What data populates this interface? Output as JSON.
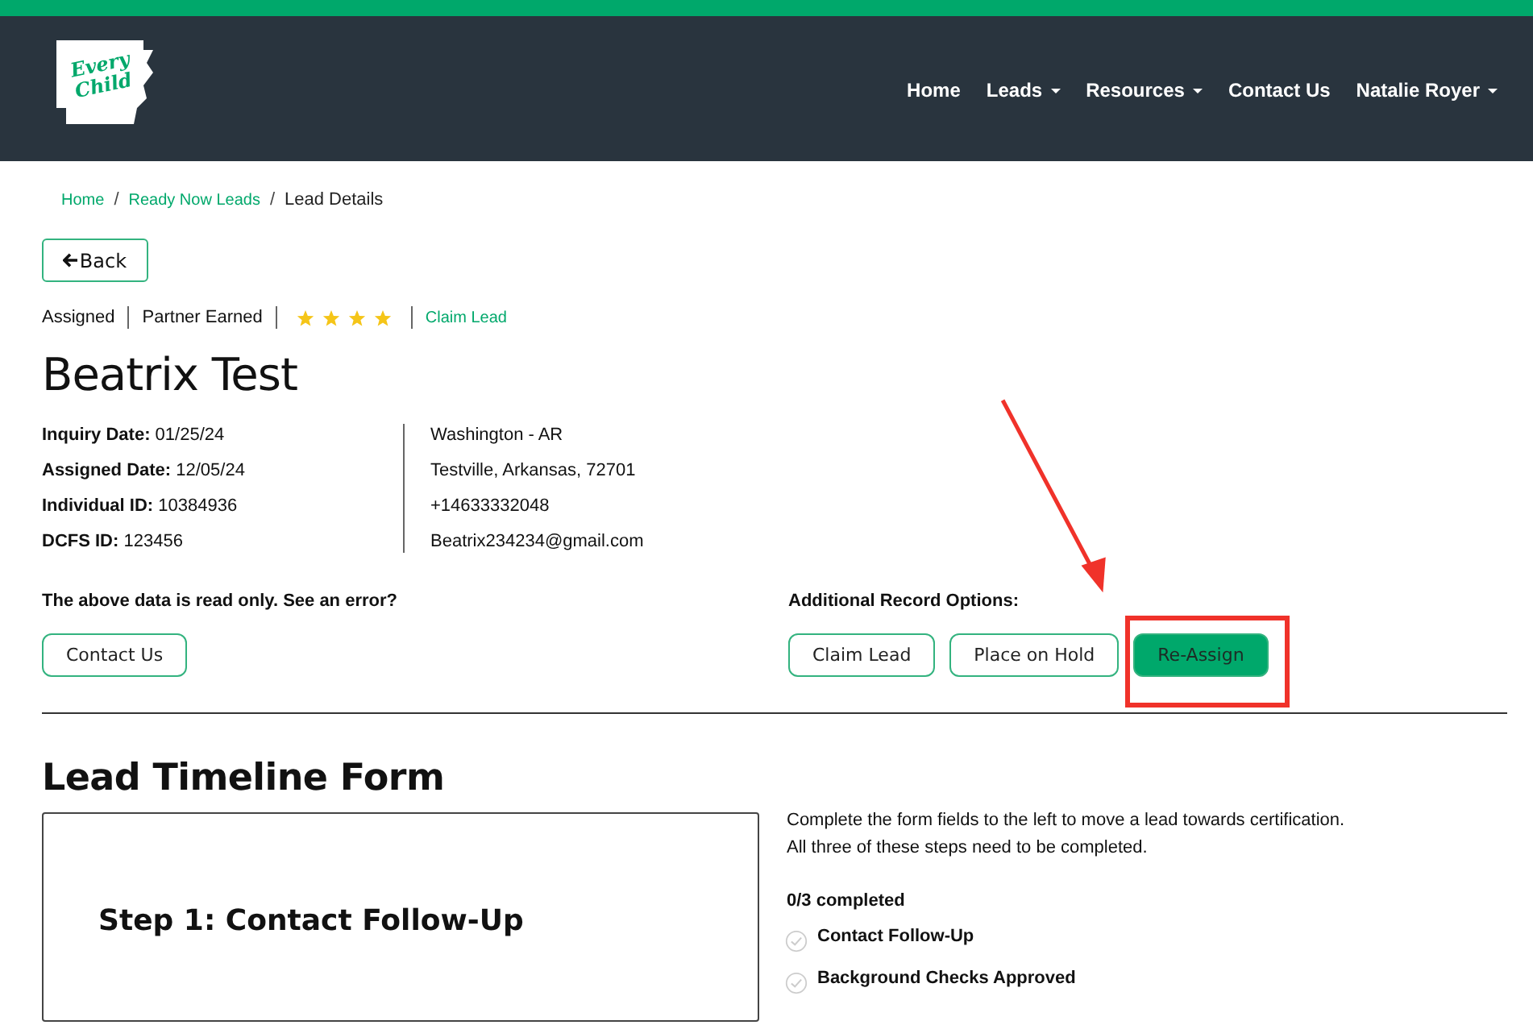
{
  "logo": {
    "line1": "Every",
    "line2": "Child"
  },
  "nav": [
    {
      "label": "Home",
      "dropdown": false
    },
    {
      "label": "Leads",
      "dropdown": true
    },
    {
      "label": "Resources",
      "dropdown": true
    },
    {
      "label": "Contact Us",
      "dropdown": false
    },
    {
      "label": "Natalie Royer",
      "dropdown": true
    }
  ],
  "breadcrumb_separator": "/",
  "breadcrumb": [
    {
      "label": "Home",
      "link": true
    },
    {
      "label": "Ready Now Leads",
      "link": true
    },
    {
      "label": "Lead Details",
      "link": false
    }
  ],
  "back_button": "Back",
  "status": {
    "assignment": "Assigned",
    "partner": "Partner Earned",
    "stars": 4,
    "claim_link": "Claim Lead"
  },
  "lead_name": "Beatrix Test",
  "details": [
    {
      "label": "Inquiry Date:",
      "value": "01/25/24"
    },
    {
      "label": "Assigned Date:",
      "value": "12/05/24"
    },
    {
      "label": "Individual ID:",
      "value": "10384936"
    },
    {
      "label": "DCFS ID:",
      "value": "123456"
    }
  ],
  "contact": [
    "Washington - AR",
    "Testville, Arkansas, 72701",
    "+14633332048",
    "Beatrix234234@gmail.com"
  ],
  "readonly_note": "The above data is read only. See an error?",
  "contact_button": "Contact Us",
  "options_heading": "Additional Record Options:",
  "option_buttons": [
    {
      "label": "Claim Lead",
      "primary": false,
      "highlighted": false
    },
    {
      "label": "Place on Hold",
      "primary": false,
      "highlighted": false
    },
    {
      "label": "Re-Assign",
      "primary": true,
      "highlighted": true
    }
  ],
  "timeline": {
    "heading": "Lead Timeline Form",
    "step_title": "Step 1: Contact Follow-Up",
    "intro": [
      "Complete the form fields to the left to move a lead towards certification.",
      "All three of these steps need to be completed."
    ],
    "progress": "0/3 completed",
    "steps": [
      {
        "label": "Contact Follow-Up",
        "checked": false
      },
      {
        "label": "Background Checks Approved",
        "checked": false
      }
    ]
  }
}
